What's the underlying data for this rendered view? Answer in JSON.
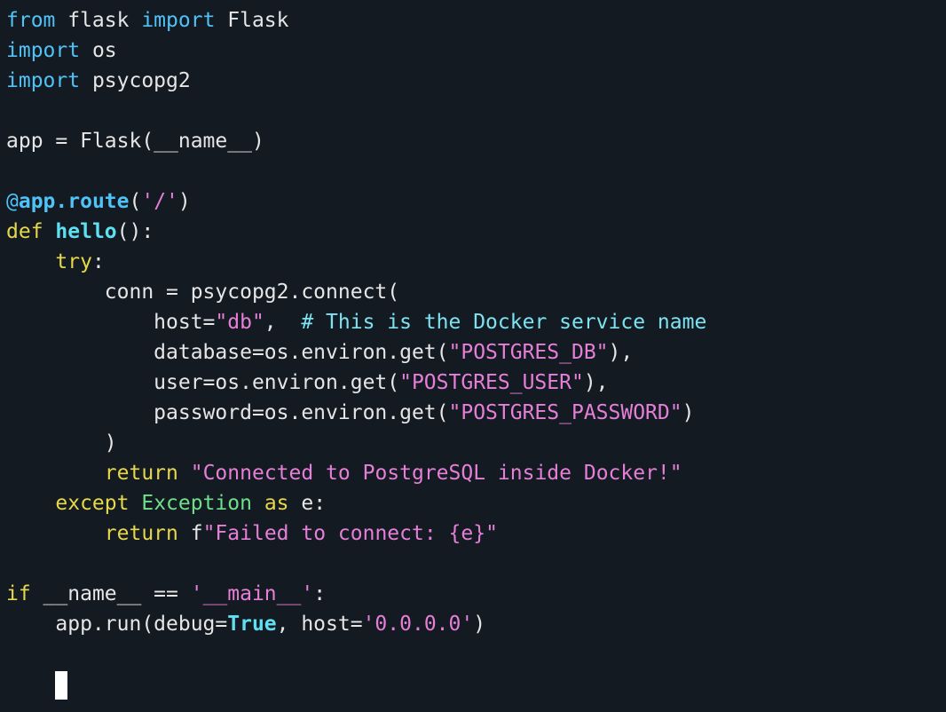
{
  "colors": {
    "background": "#141a22",
    "plain": "#e6e6e6",
    "import_keyword": "#4fc3f7",
    "keyword": "#e6d84a",
    "decorator": "#4fc3f7",
    "function_name": "#5ee0f0",
    "string": "#e57fd8",
    "comment": "#7de3f0",
    "builtin_class": "#6ee08a",
    "constant": "#5ee0f0",
    "cursor": "#ffffff"
  },
  "editor": {
    "lines": [
      [
        {
          "text": "from",
          "kind": "import_keyword"
        },
        {
          "text": " flask ",
          "kind": "plain"
        },
        {
          "text": "import",
          "kind": "import_keyword"
        },
        {
          "text": " Flask",
          "kind": "plain"
        }
      ],
      [
        {
          "text": "import",
          "kind": "import_keyword"
        },
        {
          "text": " os",
          "kind": "plain"
        }
      ],
      [
        {
          "text": "import",
          "kind": "import_keyword"
        },
        {
          "text": " psycopg2",
          "kind": "plain"
        }
      ],
      [],
      [
        {
          "text": "app = Flask(__name__)",
          "kind": "plain"
        }
      ],
      [],
      [
        {
          "text": "@",
          "kind": "decorator"
        },
        {
          "text": "app.route",
          "kind": "decorator",
          "bold": true
        },
        {
          "text": "(",
          "kind": "plain"
        },
        {
          "text": "'/'",
          "kind": "string"
        },
        {
          "text": ")",
          "kind": "plain"
        }
      ],
      [
        {
          "text": "def",
          "kind": "keyword"
        },
        {
          "text": " ",
          "kind": "plain"
        },
        {
          "text": "hello",
          "kind": "function_name",
          "bold": true
        },
        {
          "text": "():",
          "kind": "plain"
        }
      ],
      [
        {
          "text": "    ",
          "kind": "plain"
        },
        {
          "text": "try",
          "kind": "keyword"
        },
        {
          "text": ":",
          "kind": "plain"
        }
      ],
      [
        {
          "text": "        conn = psycopg2.connect(",
          "kind": "plain"
        }
      ],
      [
        {
          "text": "            host=",
          "kind": "plain"
        },
        {
          "text": "\"db\"",
          "kind": "string"
        },
        {
          "text": ",  ",
          "kind": "plain"
        },
        {
          "text": "# This is the Docker service name",
          "kind": "comment"
        }
      ],
      [
        {
          "text": "            database=os.environ.get(",
          "kind": "plain"
        },
        {
          "text": "\"POSTGRES_DB\"",
          "kind": "string"
        },
        {
          "text": "),",
          "kind": "plain"
        }
      ],
      [
        {
          "text": "            user=os.environ.get(",
          "kind": "plain"
        },
        {
          "text": "\"POSTGRES_USER\"",
          "kind": "string"
        },
        {
          "text": "),",
          "kind": "plain"
        }
      ],
      [
        {
          "text": "            password=os.environ.get(",
          "kind": "plain"
        },
        {
          "text": "\"POSTGRES_PASSWORD\"",
          "kind": "string"
        },
        {
          "text": ")",
          "kind": "plain"
        }
      ],
      [
        {
          "text": "        )",
          "kind": "plain"
        }
      ],
      [
        {
          "text": "        ",
          "kind": "plain"
        },
        {
          "text": "return",
          "kind": "keyword"
        },
        {
          "text": " ",
          "kind": "plain"
        },
        {
          "text": "\"Connected to PostgreSQL inside Docker!\"",
          "kind": "string"
        }
      ],
      [
        {
          "text": "    ",
          "kind": "plain"
        },
        {
          "text": "except",
          "kind": "keyword"
        },
        {
          "text": " ",
          "kind": "plain"
        },
        {
          "text": "Exception",
          "kind": "builtin_class"
        },
        {
          "text": " ",
          "kind": "plain"
        },
        {
          "text": "as",
          "kind": "keyword"
        },
        {
          "text": " e:",
          "kind": "plain"
        }
      ],
      [
        {
          "text": "        ",
          "kind": "plain"
        },
        {
          "text": "return",
          "kind": "keyword"
        },
        {
          "text": " f",
          "kind": "plain"
        },
        {
          "text": "\"Failed to connect: {e}\"",
          "kind": "string"
        }
      ],
      [],
      [
        {
          "text": "if",
          "kind": "keyword"
        },
        {
          "text": " __name__ == ",
          "kind": "plain"
        },
        {
          "text": "'__main__'",
          "kind": "string"
        },
        {
          "text": ":",
          "kind": "plain"
        }
      ],
      [
        {
          "text": "    app.run(debug=",
          "kind": "plain"
        },
        {
          "text": "True",
          "kind": "constant",
          "bold": true
        },
        {
          "text": ", host=",
          "kind": "plain"
        },
        {
          "text": "'0.0.0.0'",
          "kind": "string"
        },
        {
          "text": ")",
          "kind": "plain"
        }
      ],
      [],
      [
        {
          "text": "    ",
          "kind": "plain"
        },
        {
          "text": "",
          "kind": "cursor"
        }
      ]
    ]
  }
}
